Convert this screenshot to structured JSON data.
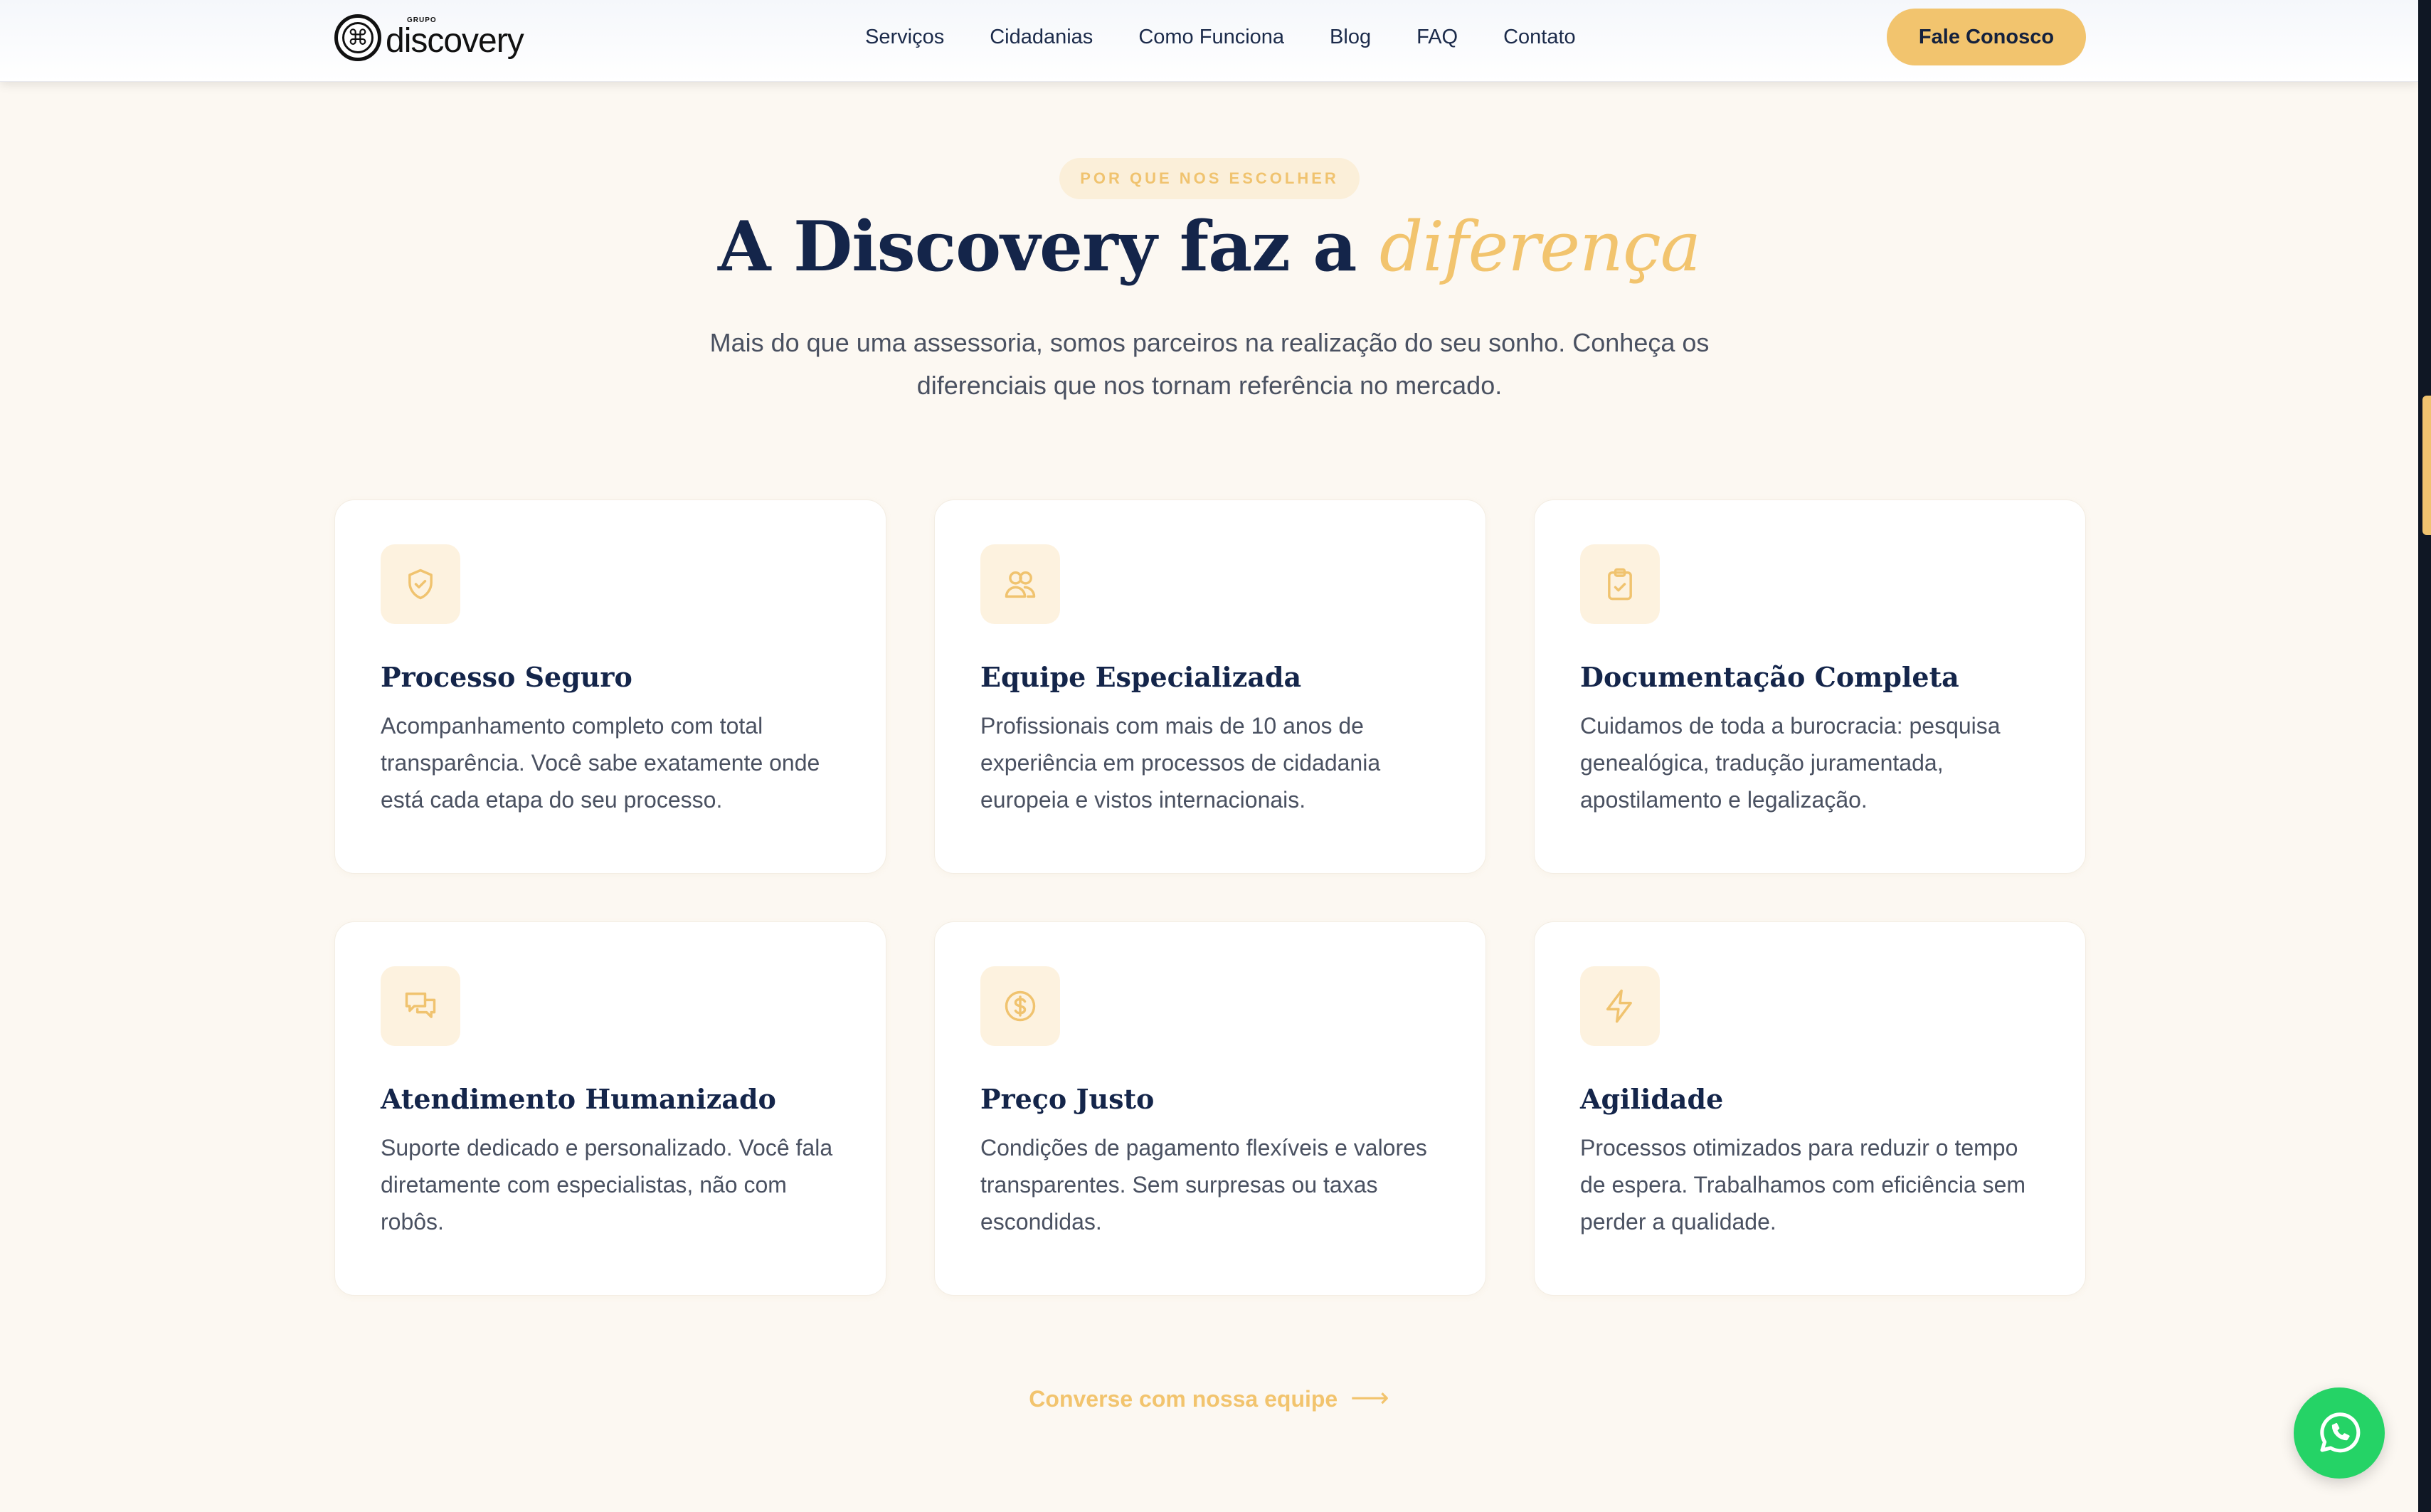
{
  "header": {
    "logo_small": "GRUPO",
    "logo_word": "discovery",
    "nav": [
      "Serviços",
      "Cidadanias",
      "Como Funciona",
      "Blog",
      "FAQ",
      "Contato"
    ],
    "cta": "Fale Conosco"
  },
  "section": {
    "eyebrow": "POR QUE NOS ESCOLHER",
    "title_main": "A Discovery faz a ",
    "title_accent": "diferença",
    "subtitle": "Mais do que uma assessoria, somos parceiros na realização do seu sonho. Conheça os diferenciais que nos tornam referência no mercado."
  },
  "cards": [
    {
      "icon": "shield-check-icon",
      "title": "Processo Seguro",
      "text": "Acompanhamento completo com total transparência. Você sabe exatamente onde está cada etapa do seu processo."
    },
    {
      "icon": "users-icon",
      "title": "Equipe Especializada",
      "text": "Profissionais com mais de 10 anos de experiência em processos de cidadania europeia e vistos internacionais."
    },
    {
      "icon": "clipboard-check-icon",
      "title": "Documentação Completa",
      "text": "Cuidamos de toda a burocracia: pesquisa genealógica, tradução juramentada, apostilamento e legalização."
    },
    {
      "icon": "chat-bubbles-icon",
      "title": "Atendimento Humanizado",
      "text": "Suporte dedicado e personalizado. Você fala diretamente com especialistas, não com robôs."
    },
    {
      "icon": "dollar-circle-icon",
      "title": "Preço Justo",
      "text": "Condições de pagamento flexíveis e valores transparentes. Sem surpresas ou taxas escondidas."
    },
    {
      "icon": "lightning-icon",
      "title": "Agilidade",
      "text": "Processos otimizados para reduzir o tempo de espera. Trabalhamos com eficiência sem perder a qualidade."
    }
  ],
  "bottom_link": "Converse com nossa equipe",
  "colors": {
    "accent": "#f2c46e",
    "navy": "#14254a",
    "background": "#fcf8f2",
    "whatsapp": "#25d366"
  }
}
